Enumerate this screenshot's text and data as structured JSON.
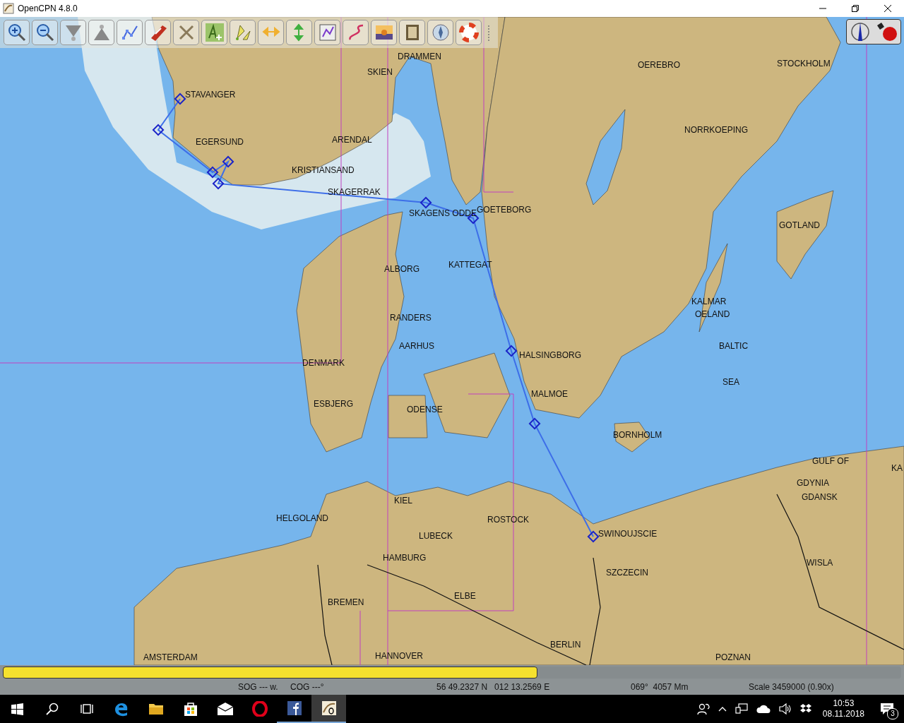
{
  "window": {
    "title": "OpenCPN 4.8.0"
  },
  "map": {
    "labels": [
      {
        "text": "DRAMMEN"
      },
      {
        "text": "SKIEN"
      },
      {
        "text": "STAVANGER"
      },
      {
        "text": "OEREBRO"
      },
      {
        "text": "STOCKHOLM"
      },
      {
        "text": "NORRKOEPING"
      },
      {
        "text": "EGERSUND"
      },
      {
        "text": "ARENDAL"
      },
      {
        "text": "KRISTIANSAND"
      },
      {
        "text": "SKAGERRAK"
      },
      {
        "text": "GOETEBORG"
      },
      {
        "text": "SKAGENS ODDE"
      },
      {
        "text": "GOTLAND"
      },
      {
        "text": "ALBORG"
      },
      {
        "text": "KATTEGAT"
      },
      {
        "text": "KALMAR"
      },
      {
        "text": "OELAND"
      },
      {
        "text": "RANDERS"
      },
      {
        "text": "AARHUS"
      },
      {
        "text": "BALTIC"
      },
      {
        "text": "HALSINGBORG"
      },
      {
        "text": "DENMARK"
      },
      {
        "text": "SEA"
      },
      {
        "text": "MALMOE"
      },
      {
        "text": "ESBJERG"
      },
      {
        "text": "ODENSE"
      },
      {
        "text": "BORNHOLM"
      },
      {
        "text": "GULF OF"
      },
      {
        "text": "KA"
      },
      {
        "text": "GDYNIA"
      },
      {
        "text": "GDANSK"
      },
      {
        "text": "KIEL"
      },
      {
        "text": "HELGOLAND"
      },
      {
        "text": "ROSTOCK"
      },
      {
        "text": "SWINOUJSCIE"
      },
      {
        "text": "LUBECK"
      },
      {
        "text": "HAMBURG"
      },
      {
        "text": "WISLA"
      },
      {
        "text": "SZCZECIN"
      },
      {
        "text": "ELBE"
      },
      {
        "text": "BREMEN"
      },
      {
        "text": "BERLIN"
      },
      {
        "text": "AMSTERDAM"
      },
      {
        "text": "HANNOVER"
      },
      {
        "text": "POZNAN"
      }
    ]
  },
  "progress": {
    "level": 0.595
  },
  "status_bar": {
    "sog": "SOG --- w.",
    "cog": "COG ---°",
    "position": "56 49.2327 N   012 13.2569 E",
    "bearing_distance": "069°  4057 Mm",
    "scale": "Scale 3459000 (0.90x)"
  },
  "taskbar": {
    "time": "10:53",
    "date": "08.11.2018",
    "notifications": "3"
  }
}
